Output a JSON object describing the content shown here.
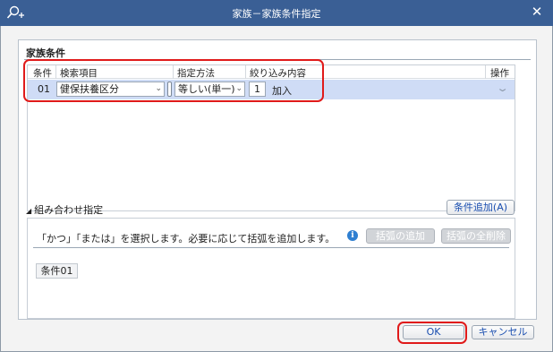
{
  "window": {
    "title": "家族－家族条件指定",
    "close_icon": "close-icon"
  },
  "conditions_section": {
    "title": "家族条件",
    "headers": {
      "condition": "条件",
      "search_item": "検索項目",
      "method": "指定方法",
      "filter_content": "絞り込み内容",
      "operation": "操作"
    },
    "row": {
      "number": "01",
      "search_item": "健保扶養区分",
      "method": "等しい(単一)",
      "value_code": "1",
      "value_label": "加入"
    }
  },
  "combination": {
    "label": "組み合わせ指定",
    "add_condition_button": "条件追加(A)",
    "message": "「かつ」「または」を選択します。必要に応じて括弧を追加します。",
    "add_paren_button": "括弧の追加",
    "delete_all_paren_button": "括弧の全削除",
    "chip": "条件01"
  },
  "footer": {
    "ok_button": "OK",
    "cancel_button": "キャンセル"
  },
  "colors": {
    "titlebar": "#3a5f95",
    "row_selected": "#cfdcf6",
    "highlight_red": "#e01a1a",
    "link_blue": "#1b4fb0"
  }
}
